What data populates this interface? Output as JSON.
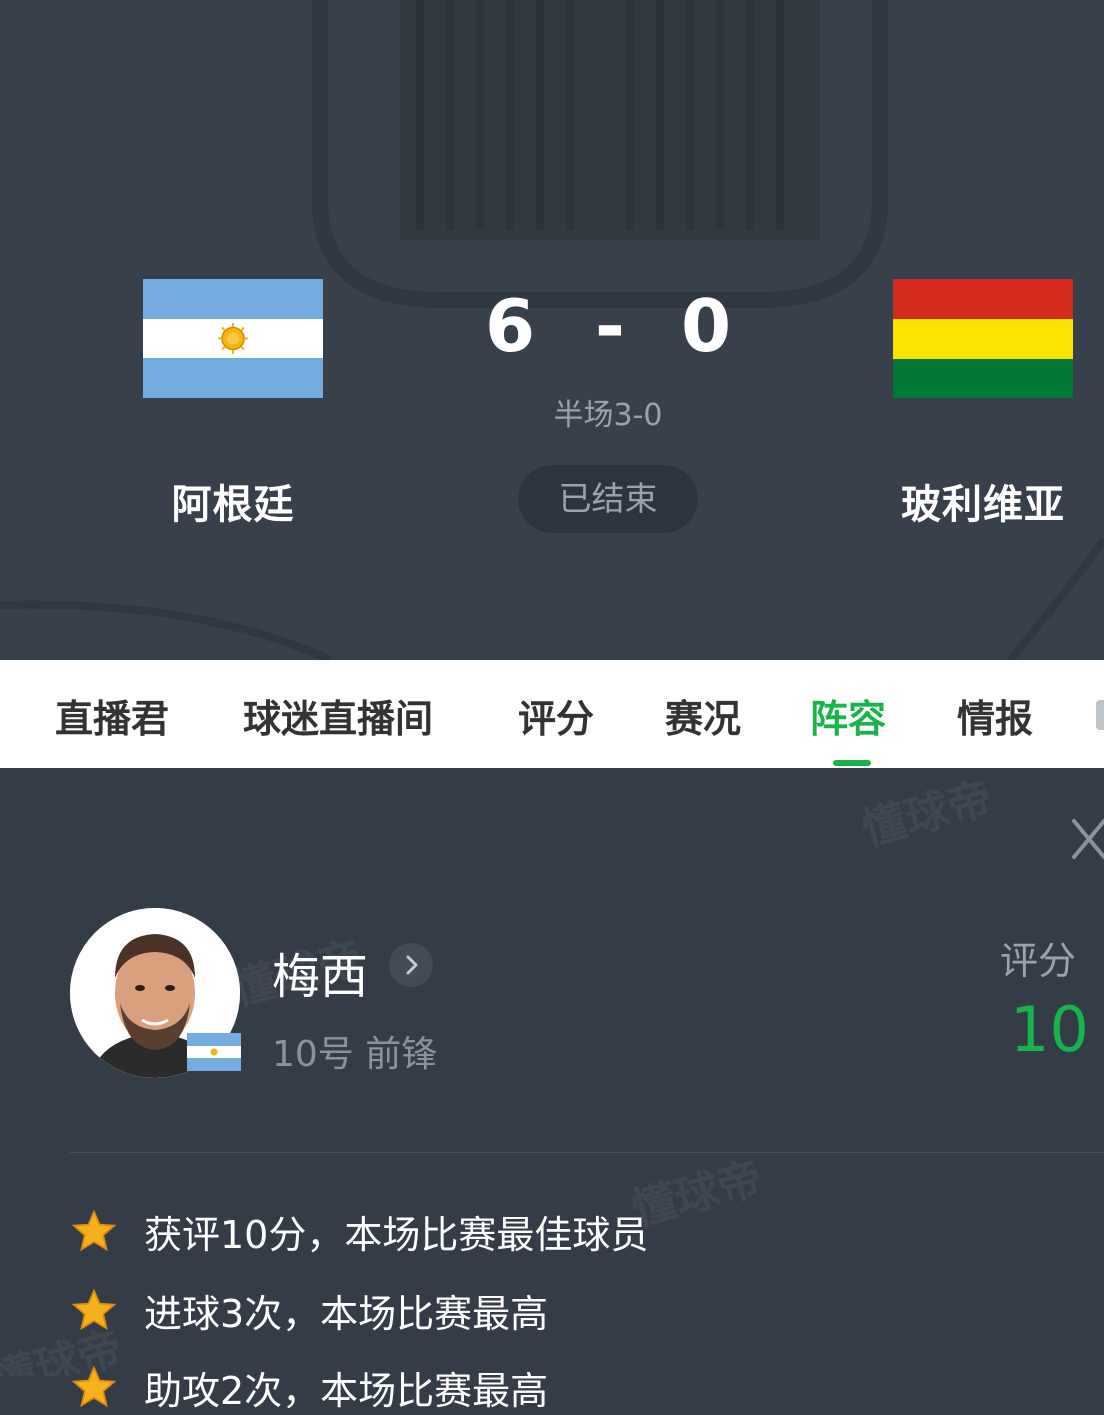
{
  "match": {
    "home_team": "阿根廷",
    "away_team": "玻利维亚",
    "home_score": "6",
    "score_separator": "-",
    "away_score": "0",
    "halftime": "半场3-0",
    "status": "已结束"
  },
  "tabs": [
    {
      "label": "直播君"
    },
    {
      "label": "球迷直播间"
    },
    {
      "label": "评分"
    },
    {
      "label": "赛况"
    },
    {
      "label": "阵容",
      "active": true
    },
    {
      "label": "情报"
    }
  ],
  "player": {
    "name": "梅西",
    "number_position": "10号 前锋",
    "rating_label": "评分",
    "rating": "10"
  },
  "highlights": [
    "获评10分，本场比赛最佳球员",
    "进球3次，本场比赛最高",
    "助攻2次，本场比赛最高"
  ],
  "watermark": "懂球帝",
  "colors": {
    "accent_green": "#18b34b",
    "header_bg": "#38414b",
    "panel_bg": "#343d47",
    "bolivia_red": "#d52b1e",
    "bolivia_yellow": "#f9e300",
    "bolivia_green": "#007934",
    "argentina_blue": "#74acdf"
  },
  "icons": {
    "close": "close-icon",
    "chevron": "chevron-right-icon",
    "star": "star-icon"
  }
}
